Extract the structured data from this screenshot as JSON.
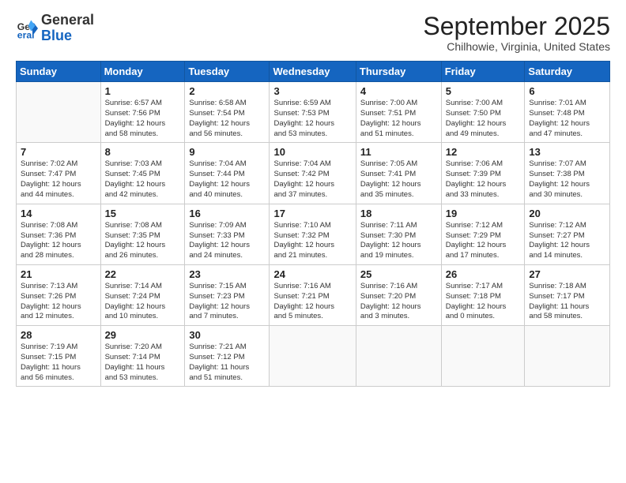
{
  "header": {
    "logo_general": "General",
    "logo_blue": "Blue",
    "month_title": "September 2025",
    "location": "Chilhowie, Virginia, United States"
  },
  "weekdays": [
    "Sunday",
    "Monday",
    "Tuesday",
    "Wednesday",
    "Thursday",
    "Friday",
    "Saturday"
  ],
  "weeks": [
    [
      {
        "day": "",
        "info": ""
      },
      {
        "day": "1",
        "info": "Sunrise: 6:57 AM\nSunset: 7:56 PM\nDaylight: 12 hours\nand 58 minutes."
      },
      {
        "day": "2",
        "info": "Sunrise: 6:58 AM\nSunset: 7:54 PM\nDaylight: 12 hours\nand 56 minutes."
      },
      {
        "day": "3",
        "info": "Sunrise: 6:59 AM\nSunset: 7:53 PM\nDaylight: 12 hours\nand 53 minutes."
      },
      {
        "day": "4",
        "info": "Sunrise: 7:00 AM\nSunset: 7:51 PM\nDaylight: 12 hours\nand 51 minutes."
      },
      {
        "day": "5",
        "info": "Sunrise: 7:00 AM\nSunset: 7:50 PM\nDaylight: 12 hours\nand 49 minutes."
      },
      {
        "day": "6",
        "info": "Sunrise: 7:01 AM\nSunset: 7:48 PM\nDaylight: 12 hours\nand 47 minutes."
      }
    ],
    [
      {
        "day": "7",
        "info": "Sunrise: 7:02 AM\nSunset: 7:47 PM\nDaylight: 12 hours\nand 44 minutes."
      },
      {
        "day": "8",
        "info": "Sunrise: 7:03 AM\nSunset: 7:45 PM\nDaylight: 12 hours\nand 42 minutes."
      },
      {
        "day": "9",
        "info": "Sunrise: 7:04 AM\nSunset: 7:44 PM\nDaylight: 12 hours\nand 40 minutes."
      },
      {
        "day": "10",
        "info": "Sunrise: 7:04 AM\nSunset: 7:42 PM\nDaylight: 12 hours\nand 37 minutes."
      },
      {
        "day": "11",
        "info": "Sunrise: 7:05 AM\nSunset: 7:41 PM\nDaylight: 12 hours\nand 35 minutes."
      },
      {
        "day": "12",
        "info": "Sunrise: 7:06 AM\nSunset: 7:39 PM\nDaylight: 12 hours\nand 33 minutes."
      },
      {
        "day": "13",
        "info": "Sunrise: 7:07 AM\nSunset: 7:38 PM\nDaylight: 12 hours\nand 30 minutes."
      }
    ],
    [
      {
        "day": "14",
        "info": "Sunrise: 7:08 AM\nSunset: 7:36 PM\nDaylight: 12 hours\nand 28 minutes."
      },
      {
        "day": "15",
        "info": "Sunrise: 7:08 AM\nSunset: 7:35 PM\nDaylight: 12 hours\nand 26 minutes."
      },
      {
        "day": "16",
        "info": "Sunrise: 7:09 AM\nSunset: 7:33 PM\nDaylight: 12 hours\nand 24 minutes."
      },
      {
        "day": "17",
        "info": "Sunrise: 7:10 AM\nSunset: 7:32 PM\nDaylight: 12 hours\nand 21 minutes."
      },
      {
        "day": "18",
        "info": "Sunrise: 7:11 AM\nSunset: 7:30 PM\nDaylight: 12 hours\nand 19 minutes."
      },
      {
        "day": "19",
        "info": "Sunrise: 7:12 AM\nSunset: 7:29 PM\nDaylight: 12 hours\nand 17 minutes."
      },
      {
        "day": "20",
        "info": "Sunrise: 7:12 AM\nSunset: 7:27 PM\nDaylight: 12 hours\nand 14 minutes."
      }
    ],
    [
      {
        "day": "21",
        "info": "Sunrise: 7:13 AM\nSunset: 7:26 PM\nDaylight: 12 hours\nand 12 minutes."
      },
      {
        "day": "22",
        "info": "Sunrise: 7:14 AM\nSunset: 7:24 PM\nDaylight: 12 hours\nand 10 minutes."
      },
      {
        "day": "23",
        "info": "Sunrise: 7:15 AM\nSunset: 7:23 PM\nDaylight: 12 hours\nand 7 minutes."
      },
      {
        "day": "24",
        "info": "Sunrise: 7:16 AM\nSunset: 7:21 PM\nDaylight: 12 hours\nand 5 minutes."
      },
      {
        "day": "25",
        "info": "Sunrise: 7:16 AM\nSunset: 7:20 PM\nDaylight: 12 hours\nand 3 minutes."
      },
      {
        "day": "26",
        "info": "Sunrise: 7:17 AM\nSunset: 7:18 PM\nDaylight: 12 hours\nand 0 minutes."
      },
      {
        "day": "27",
        "info": "Sunrise: 7:18 AM\nSunset: 7:17 PM\nDaylight: 11 hours\nand 58 minutes."
      }
    ],
    [
      {
        "day": "28",
        "info": "Sunrise: 7:19 AM\nSunset: 7:15 PM\nDaylight: 11 hours\nand 56 minutes."
      },
      {
        "day": "29",
        "info": "Sunrise: 7:20 AM\nSunset: 7:14 PM\nDaylight: 11 hours\nand 53 minutes."
      },
      {
        "day": "30",
        "info": "Sunrise: 7:21 AM\nSunset: 7:12 PM\nDaylight: 11 hours\nand 51 minutes."
      },
      {
        "day": "",
        "info": ""
      },
      {
        "day": "",
        "info": ""
      },
      {
        "day": "",
        "info": ""
      },
      {
        "day": "",
        "info": ""
      }
    ]
  ]
}
